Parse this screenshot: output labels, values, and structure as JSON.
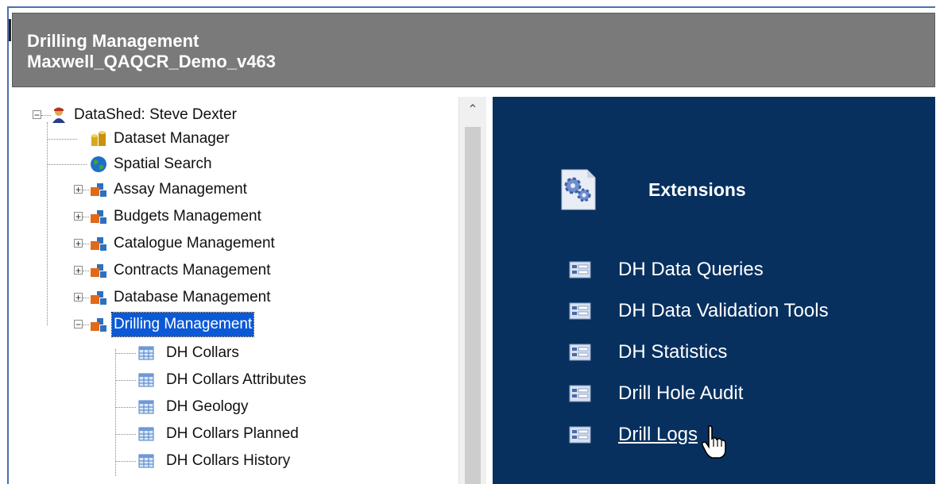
{
  "header": {
    "line1": "Drilling Management",
    "line2": "Maxwell_QAQCR_Demo_v463"
  },
  "tree": {
    "root": {
      "label": "DataShed: Steve Dexter",
      "icon": "user-icon"
    },
    "items": [
      {
        "label": "Dataset Manager",
        "icon": "database-cylinders-icon"
      },
      {
        "label": "Spatial Search",
        "icon": "globe-icon"
      },
      {
        "label": "Assay Management",
        "icon": "module-icon"
      },
      {
        "label": "Budgets Management",
        "icon": "module-icon"
      },
      {
        "label": "Catalogue Management",
        "icon": "module-icon"
      },
      {
        "label": "Contracts Management",
        "icon": "module-icon"
      },
      {
        "label": "Database Management",
        "icon": "module-icon"
      },
      {
        "label": "Drilling Management",
        "icon": "module-icon",
        "selected": true
      }
    ],
    "children": [
      {
        "label": "DH Collars",
        "icon": "table-icon"
      },
      {
        "label": "DH Collars Attributes",
        "icon": "table-icon"
      },
      {
        "label": "DH Geology",
        "icon": "table-icon"
      },
      {
        "label": "DH Collars Planned",
        "icon": "table-icon"
      },
      {
        "label": "DH Collars History",
        "icon": "table-icon"
      }
    ]
  },
  "panel": {
    "title": "Extensions",
    "title_icon": "gears-document-icon",
    "links": [
      {
        "label": "DH Data Queries",
        "icon": "form-icon"
      },
      {
        "label": "DH Data Validation Tools",
        "icon": "form-icon"
      },
      {
        "label": "DH Statistics",
        "icon": "form-icon"
      },
      {
        "label": "Drill Hole Audit",
        "icon": "form-icon"
      },
      {
        "label": "Drill Logs",
        "icon": "form-icon",
        "hovered": true
      }
    ]
  },
  "colors": {
    "header_bg": "#7a7a7a",
    "panel_bg": "#07305f",
    "selection": "#0b59d6"
  }
}
